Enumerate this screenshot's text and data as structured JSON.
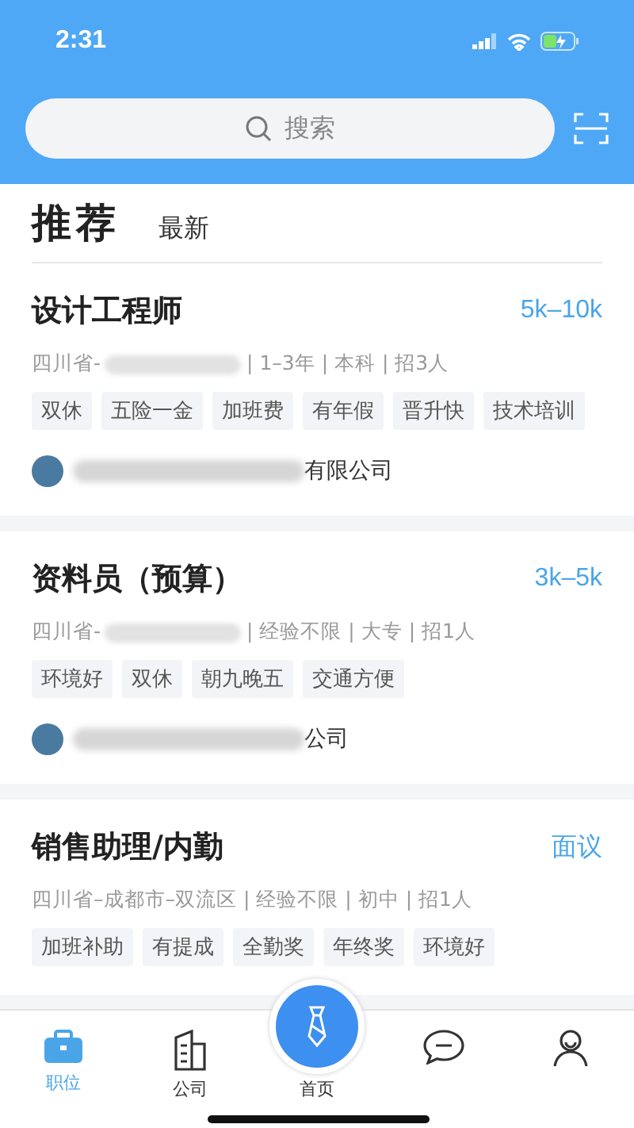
{
  "status_bar": {
    "time": "2:31"
  },
  "search": {
    "placeholder": "搜索"
  },
  "feed_tabs": [
    {
      "label": "推荐",
      "selected": true
    },
    {
      "label": "最新",
      "selected": false
    }
  ],
  "jobs": [
    {
      "title": "设计工程师",
      "salary": "5k–10k",
      "location": "四川省-",
      "location_redacted": true,
      "meta": "| 1–3年 | 本科 | 招3人",
      "tags": [
        "双休",
        "五险一金",
        "加班费",
        "有年假",
        "晋升快",
        "技术培训"
      ],
      "company": "有限公司",
      "company_redacted": true
    },
    {
      "title": "资料员（预算）",
      "salary": "3k–5k",
      "location": "四川省-",
      "location_redacted": true,
      "meta": "| 经验不限 | 大专 | 招1人",
      "tags": [
        "环境好",
        "双休",
        "朝九晚五",
        "交通方便"
      ],
      "company": "公司",
      "company_redacted": true
    },
    {
      "title": "销售助理/内勤",
      "salary": "面议",
      "location": "四川省–成都市–双流区",
      "location_redacted": false,
      "meta": "| 经验不限 | 初中 | 招1人",
      "tags": [
        "加班补助",
        "有提成",
        "全勤奖",
        "年终奖",
        "环境好"
      ]
    }
  ],
  "nav": [
    {
      "kind": "briefcase",
      "label": "职位",
      "selected": true
    },
    {
      "kind": "building",
      "label": "公司",
      "selected": false
    },
    {
      "kind": "tie",
      "label": "首页",
      "selected": false
    },
    {
      "kind": "chat",
      "selected": false
    },
    {
      "kind": "person",
      "selected": false
    }
  ]
}
